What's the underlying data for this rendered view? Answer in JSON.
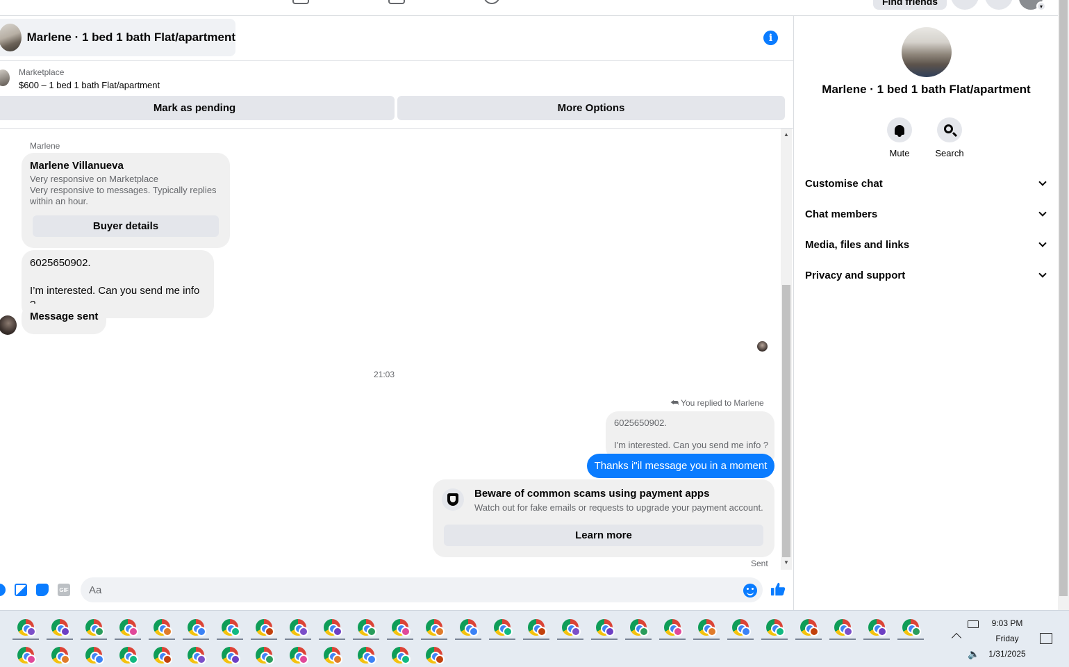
{
  "topbar": {
    "find_friends_label": "Find friends"
  },
  "chat": {
    "title": "Marlene · 1 bed 1 bath Flat/apartment",
    "listing": {
      "category": "Marketplace",
      "title": "$600 – 1 bed 1 bath Flat/apartment",
      "mark_pending_label": "Mark as pending",
      "more_options_label": "More Options"
    },
    "messages": {
      "sender_name": "Marlene",
      "profile": {
        "name": "Marlene Villanueva",
        "line1": "Very responsive on Marketplace",
        "line2": "Very responsive to messages. Typically replies within an hour.",
        "buyer_details_label": "Buyer details"
      },
      "incoming_1_line1": "6025650902.",
      "incoming_1_line2": "I’m interested. Can you send me info ?",
      "incoming_2": "Message sent",
      "timestamp": "21:03",
      "reply_label": "You replied to Marlene",
      "quoted_line1": "6025650902.",
      "quoted_line2": "I'm interested. Can you send me info ?",
      "outgoing": "Thanks i\"il message you in a moment",
      "scam_notice": {
        "title": "Beware of common scams using payment apps",
        "description": "Watch out for fake emails or requests to upgrade your payment account.",
        "learn_more_label": "Learn more"
      },
      "status": "Sent"
    },
    "composer": {
      "placeholder": "Aa",
      "gif_label": "GIF"
    }
  },
  "right_panel": {
    "name": "Marlene · 1 bed 1 bath Flat/apartment",
    "actions": [
      {
        "label": "Mute",
        "icon": "bell-icon"
      },
      {
        "label": "Search",
        "icon": "search-icon"
      }
    ],
    "sections": [
      {
        "label": "Customise chat"
      },
      {
        "label": "Chat members"
      },
      {
        "label": "Media, files and links"
      },
      {
        "label": "Privacy and support"
      }
    ]
  },
  "taskbar": {
    "time": "9:03 PM",
    "day": "Friday",
    "date": "1/31/2025"
  },
  "colors": {
    "accent": "#0a7cff",
    "bubble_in": "#f0f0f0",
    "button_gray": "#e4e6eb",
    "secondary_text": "#65676b"
  }
}
